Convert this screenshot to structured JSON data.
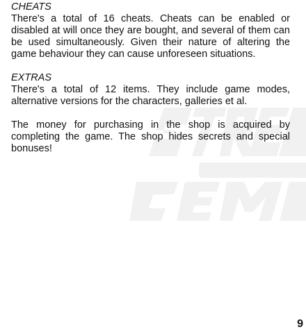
{
  "sections": [
    {
      "heading": "CHEATS",
      "body": "There's a total of 16 cheats. Cheats can be enabled or disabled at will once they are bought, and several of them can be used simultaneously. Given their nature of altering the game behaviour they can cause unforeseen situations."
    },
    {
      "heading": "EXTRAS",
      "body": "There's a total of 12 items. They include game modes, alternative versions for the characters, galleries et al."
    }
  ],
  "closing_paragraph": "The money for purchasing in the shop is acquired by completing the game. The shop hides secrets and special bonuses!",
  "page_number": "9",
  "watermark": {
    "text": "STREETS OF RAGE REMAKE",
    "color": "#f1f1f1"
  }
}
